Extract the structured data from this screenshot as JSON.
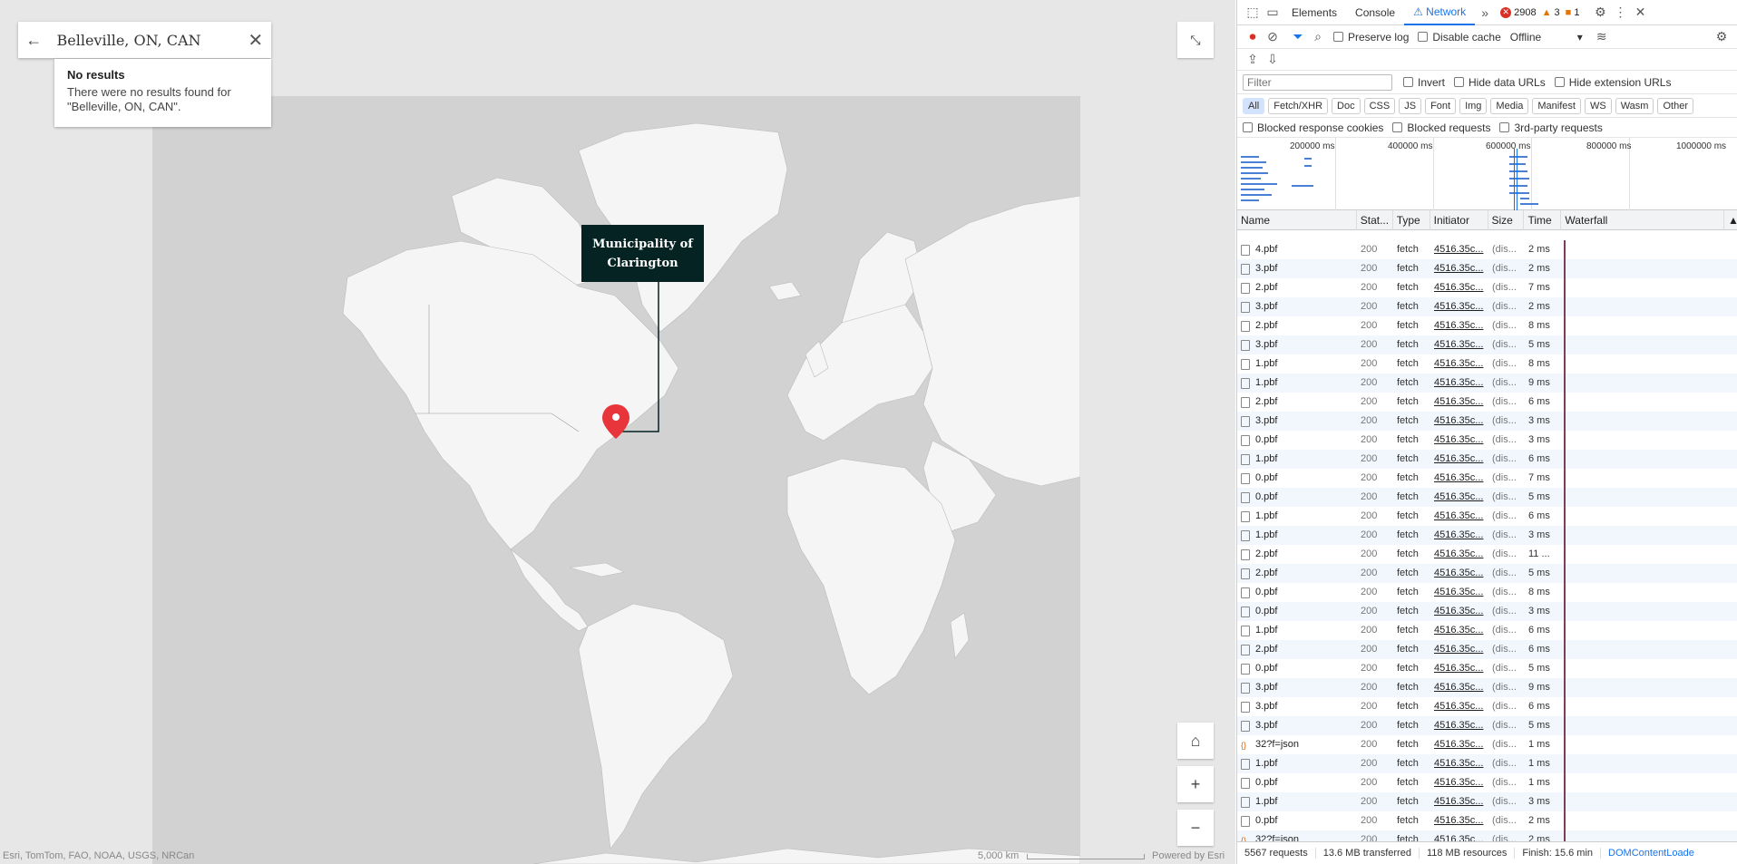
{
  "search": {
    "value": "Belleville, ON, CAN",
    "back_icon": "arrow-left-icon",
    "clear_icon": "close-icon"
  },
  "no_results": {
    "title": "No results",
    "message": "There were no results found for \"Belleville, ON, CAN\"."
  },
  "popup": {
    "label": "Municipality of Clarington"
  },
  "map_controls": {
    "home_icon": "home-icon",
    "zoom_in": "+",
    "zoom_out": "−"
  },
  "attribution": {
    "left": "Esri, TomTom, FAO, NOAA, USGS, NRCan",
    "scale": "5,000 km",
    "right": "Powered by Esri"
  },
  "devtools": {
    "tabs": [
      "Elements",
      "Console",
      "Network"
    ],
    "active_tab": "Network",
    "error_count": "2908",
    "warning_count": "3",
    "info_count": "1",
    "toolbar": {
      "preserve_log": "Preserve log",
      "disable_cache": "Disable cache",
      "throttle": "Offline"
    },
    "filter_placeholder": "Filter",
    "filter_opts": {
      "invert": "Invert",
      "hide_data": "Hide data URLs",
      "hide_ext": "Hide extension URLs"
    },
    "type_filters": [
      "All",
      "Fetch/XHR",
      "Doc",
      "CSS",
      "JS",
      "Font",
      "Img",
      "Media",
      "Manifest",
      "WS",
      "Wasm",
      "Other"
    ],
    "blocked": {
      "cookies": "Blocked response cookies",
      "requests": "Blocked requests",
      "third": "3rd-party requests"
    },
    "overview_ticks": [
      "200000 ms",
      "400000 ms",
      "600000 ms",
      "800000 ms",
      "1000000 ms"
    ],
    "columns": {
      "name": "Name",
      "status": "Stat...",
      "type": "Type",
      "initiator": "Initiator",
      "size": "Size",
      "time": "Time",
      "waterfall": "Waterfall"
    },
    "rows": [
      {
        "name": "4.pbf",
        "status": "200",
        "type": "fetch",
        "initiator": "4516.35c...",
        "size": "(dis...",
        "time": "2 ms",
        "kind": "file"
      },
      {
        "name": "3.pbf",
        "status": "200",
        "type": "fetch",
        "initiator": "4516.35c...",
        "size": "(dis...",
        "time": "2 ms",
        "kind": "file"
      },
      {
        "name": "2.pbf",
        "status": "200",
        "type": "fetch",
        "initiator": "4516.35c...",
        "size": "(dis...",
        "time": "7 ms",
        "kind": "file"
      },
      {
        "name": "3.pbf",
        "status": "200",
        "type": "fetch",
        "initiator": "4516.35c...",
        "size": "(dis...",
        "time": "2 ms",
        "kind": "file"
      },
      {
        "name": "2.pbf",
        "status": "200",
        "type": "fetch",
        "initiator": "4516.35c...",
        "size": "(dis...",
        "time": "8 ms",
        "kind": "file"
      },
      {
        "name": "3.pbf",
        "status": "200",
        "type": "fetch",
        "initiator": "4516.35c...",
        "size": "(dis...",
        "time": "5 ms",
        "kind": "file"
      },
      {
        "name": "1.pbf",
        "status": "200",
        "type": "fetch",
        "initiator": "4516.35c...",
        "size": "(dis...",
        "time": "8 ms",
        "kind": "file"
      },
      {
        "name": "1.pbf",
        "status": "200",
        "type": "fetch",
        "initiator": "4516.35c...",
        "size": "(dis...",
        "time": "9 ms",
        "kind": "file"
      },
      {
        "name": "2.pbf",
        "status": "200",
        "type": "fetch",
        "initiator": "4516.35c...",
        "size": "(dis...",
        "time": "6 ms",
        "kind": "file"
      },
      {
        "name": "3.pbf",
        "status": "200",
        "type": "fetch",
        "initiator": "4516.35c...",
        "size": "(dis...",
        "time": "3 ms",
        "kind": "file"
      },
      {
        "name": "0.pbf",
        "status": "200",
        "type": "fetch",
        "initiator": "4516.35c...",
        "size": "(dis...",
        "time": "3 ms",
        "kind": "file"
      },
      {
        "name": "1.pbf",
        "status": "200",
        "type": "fetch",
        "initiator": "4516.35c...",
        "size": "(dis...",
        "time": "6 ms",
        "kind": "file"
      },
      {
        "name": "0.pbf",
        "status": "200",
        "type": "fetch",
        "initiator": "4516.35c...",
        "size": "(dis...",
        "time": "7 ms",
        "kind": "file"
      },
      {
        "name": "0.pbf",
        "status": "200",
        "type": "fetch",
        "initiator": "4516.35c...",
        "size": "(dis...",
        "time": "5 ms",
        "kind": "file"
      },
      {
        "name": "1.pbf",
        "status": "200",
        "type": "fetch",
        "initiator": "4516.35c...",
        "size": "(dis...",
        "time": "6 ms",
        "kind": "file"
      },
      {
        "name": "1.pbf",
        "status": "200",
        "type": "fetch",
        "initiator": "4516.35c...",
        "size": "(dis...",
        "time": "3 ms",
        "kind": "file"
      },
      {
        "name": "2.pbf",
        "status": "200",
        "type": "fetch",
        "initiator": "4516.35c...",
        "size": "(dis...",
        "time": "11 ...",
        "kind": "file"
      },
      {
        "name": "2.pbf",
        "status": "200",
        "type": "fetch",
        "initiator": "4516.35c...",
        "size": "(dis...",
        "time": "5 ms",
        "kind": "file"
      },
      {
        "name": "0.pbf",
        "status": "200",
        "type": "fetch",
        "initiator": "4516.35c...",
        "size": "(dis...",
        "time": "8 ms",
        "kind": "file"
      },
      {
        "name": "0.pbf",
        "status": "200",
        "type": "fetch",
        "initiator": "4516.35c...",
        "size": "(dis...",
        "time": "3 ms",
        "kind": "file"
      },
      {
        "name": "1.pbf",
        "status": "200",
        "type": "fetch",
        "initiator": "4516.35c...",
        "size": "(dis...",
        "time": "6 ms",
        "kind": "file"
      },
      {
        "name": "2.pbf",
        "status": "200",
        "type": "fetch",
        "initiator": "4516.35c...",
        "size": "(dis...",
        "time": "6 ms",
        "kind": "file"
      },
      {
        "name": "0.pbf",
        "status": "200",
        "type": "fetch",
        "initiator": "4516.35c...",
        "size": "(dis...",
        "time": "5 ms",
        "kind": "file"
      },
      {
        "name": "3.pbf",
        "status": "200",
        "type": "fetch",
        "initiator": "4516.35c...",
        "size": "(dis...",
        "time": "9 ms",
        "kind": "file"
      },
      {
        "name": "3.pbf",
        "status": "200",
        "type": "fetch",
        "initiator": "4516.35c...",
        "size": "(dis...",
        "time": "6 ms",
        "kind": "file"
      },
      {
        "name": "3.pbf",
        "status": "200",
        "type": "fetch",
        "initiator": "4516.35c...",
        "size": "(dis...",
        "time": "5 ms",
        "kind": "file"
      },
      {
        "name": "32?f=json",
        "status": "200",
        "type": "fetch",
        "initiator": "4516.35c...",
        "size": "(dis...",
        "time": "1 ms",
        "kind": "json"
      },
      {
        "name": "1.pbf",
        "status": "200",
        "type": "fetch",
        "initiator": "4516.35c...",
        "size": "(dis...",
        "time": "1 ms",
        "kind": "file"
      },
      {
        "name": "0.pbf",
        "status": "200",
        "type": "fetch",
        "initiator": "4516.35c...",
        "size": "(dis...",
        "time": "1 ms",
        "kind": "file"
      },
      {
        "name": "1.pbf",
        "status": "200",
        "type": "fetch",
        "initiator": "4516.35c...",
        "size": "(dis...",
        "time": "3 ms",
        "kind": "file"
      },
      {
        "name": "0.pbf",
        "status": "200",
        "type": "fetch",
        "initiator": "4516.35c...",
        "size": "(dis...",
        "time": "2 ms",
        "kind": "file"
      },
      {
        "name": "32?f=json",
        "status": "200",
        "type": "fetch",
        "initiator": "4516.35c...",
        "size": "(dis...",
        "time": "2 ms",
        "kind": "json"
      }
    ],
    "status_bar": {
      "requests": "5567 requests",
      "transferred": "13.6 MB transferred",
      "resources": "118 MB resources",
      "finish": "Finish: 15.6 min",
      "dcl": "DOMContentLoade"
    }
  }
}
